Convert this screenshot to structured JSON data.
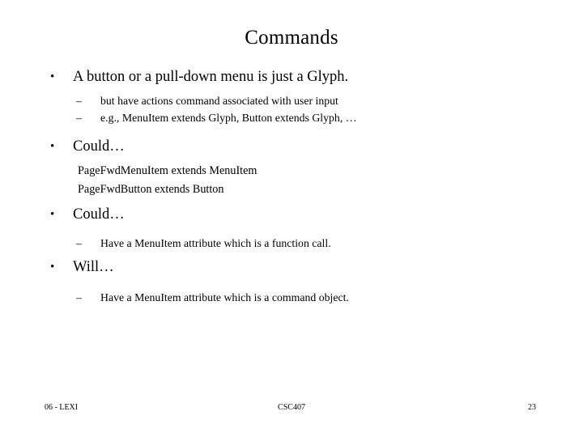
{
  "slide": {
    "title": "Commands",
    "background_color": "#ffffff",
    "text_color": "#000000",
    "bullet_marker": "•",
    "dash_marker": "–",
    "blocks": [
      {
        "level": 1,
        "text": "A button or a pull-down menu is just a Glyph."
      },
      {
        "level": 2,
        "text": "but have actions command associated with user input"
      },
      {
        "level": 2,
        "text": "e.g., MenuItem extends Glyph, Button extends Glyph, …"
      },
      {
        "level": 1,
        "text": "Could…"
      },
      {
        "level": 0,
        "text": "PageFwdMenuItem extends MenuItem"
      },
      {
        "level": 0,
        "text": "PageFwdButton extends Button"
      },
      {
        "level": 1,
        "text": "Could…"
      },
      {
        "level": 2,
        "text": "Have a MenuItem attribute which is a function call."
      },
      {
        "level": 1,
        "text": "Will…"
      },
      {
        "level": 2,
        "text": "Have a MenuItem attribute which is a command object."
      }
    ]
  },
  "footer": {
    "left": "06 - LEXI",
    "center": "CSC407",
    "page_number": "23"
  }
}
